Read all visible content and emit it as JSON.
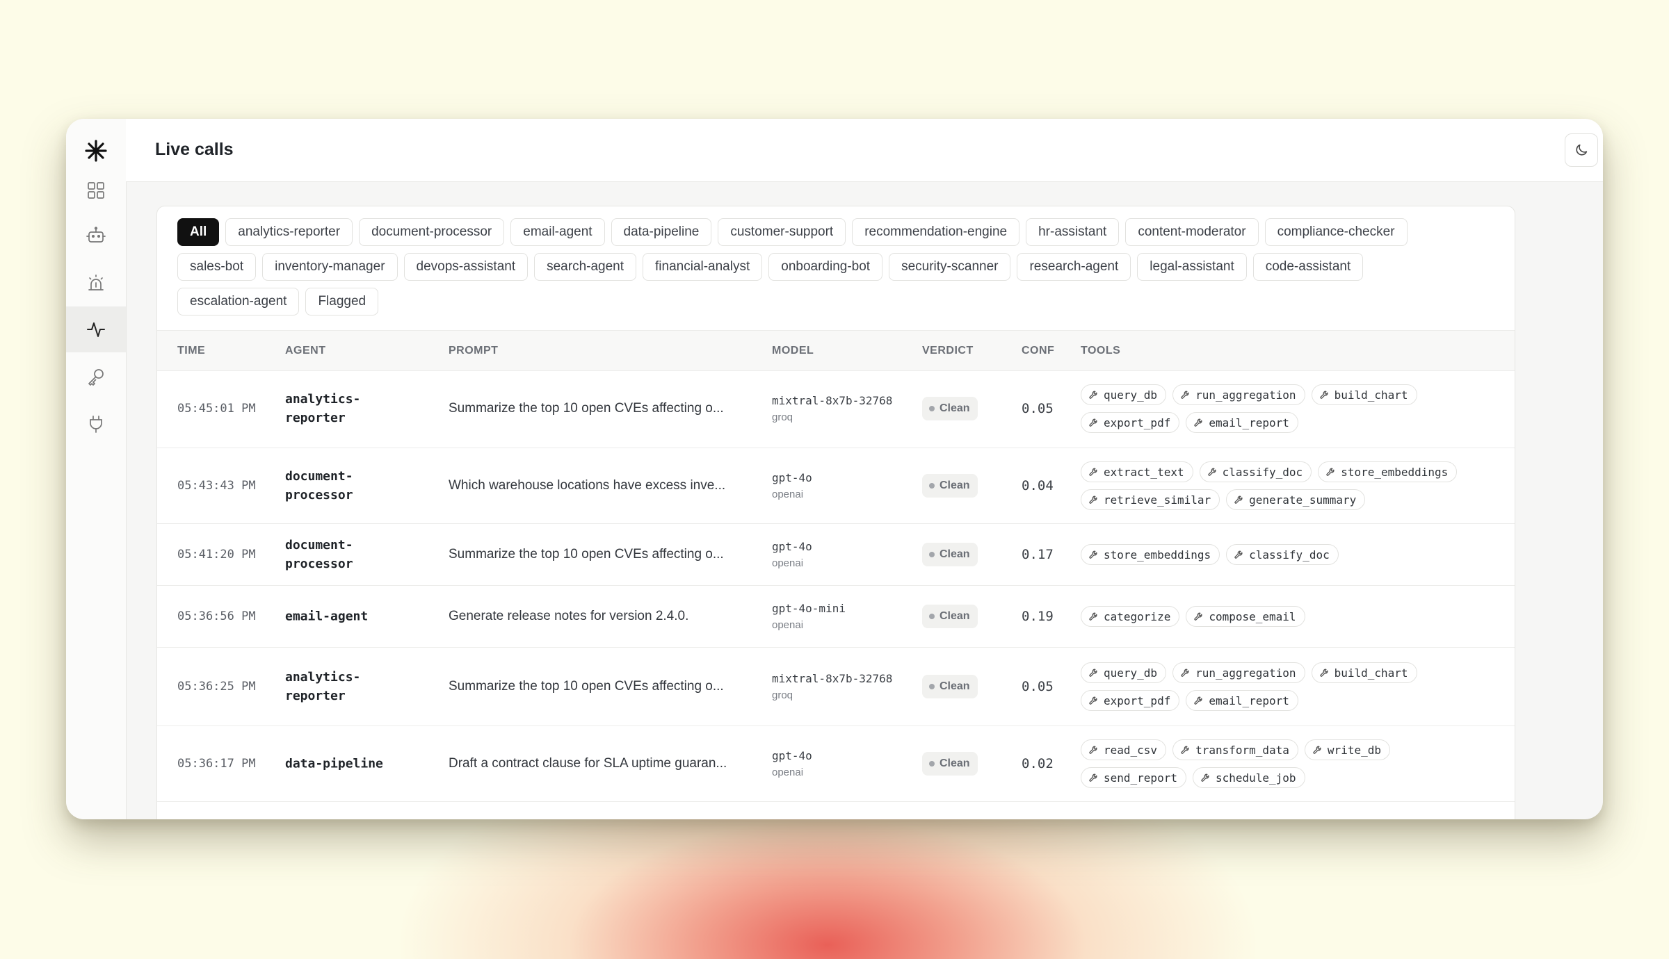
{
  "header": {
    "title": "Live calls"
  },
  "filters": [
    "All",
    "analytics-reporter",
    "document-processor",
    "email-agent",
    "data-pipeline",
    "customer-support",
    "recommendation-engine",
    "hr-assistant",
    "content-moderator",
    "compliance-checker",
    "sales-bot",
    "inventory-manager",
    "devops-assistant",
    "search-agent",
    "financial-analyst",
    "onboarding-bot",
    "security-scanner",
    "research-agent",
    "legal-assistant",
    "code-assistant",
    "escalation-agent",
    "Flagged"
  ],
  "active_filter": "All",
  "table": {
    "columns": [
      "TIME",
      "AGENT",
      "PROMPT",
      "MODEL",
      "VERDICT",
      "CONF",
      "TOOLS"
    ],
    "rows": [
      {
        "time": "05:45:01 PM",
        "agent": "analytics-reporter",
        "prompt": "Summarize the top 10 open CVEs affecting o...",
        "model": "mixtral-8x7b-32768",
        "provider": "groq",
        "verdict": "Clean",
        "conf": "0.05",
        "tools": [
          "query_db",
          "run_aggregation",
          "build_chart",
          "export_pdf",
          "email_report"
        ]
      },
      {
        "time": "05:43:43 PM",
        "agent": "document-processor",
        "prompt": "Which warehouse locations have excess inve...",
        "model": "gpt-4o",
        "provider": "openai",
        "verdict": "Clean",
        "conf": "0.04",
        "tools": [
          "extract_text",
          "classify_doc",
          "store_embeddings",
          "retrieve_similar",
          "generate_summary"
        ]
      },
      {
        "time": "05:41:20 PM",
        "agent": "document-processor",
        "prompt": "Summarize the top 10 open CVEs affecting o...",
        "model": "gpt-4o",
        "provider": "openai",
        "verdict": "Clean",
        "conf": "0.17",
        "tools": [
          "store_embeddings",
          "classify_doc"
        ]
      },
      {
        "time": "05:36:56 PM",
        "agent": "email-agent",
        "prompt": "Generate release notes for version 2.4.0.",
        "model": "gpt-4o-mini",
        "provider": "openai",
        "verdict": "Clean",
        "conf": "0.19",
        "tools": [
          "categorize",
          "compose_email"
        ]
      },
      {
        "time": "05:36:25 PM",
        "agent": "analytics-reporter",
        "prompt": "Summarize the top 10 open CVEs affecting o...",
        "model": "mixtral-8x7b-32768",
        "provider": "groq",
        "verdict": "Clean",
        "conf": "0.05",
        "tools": [
          "query_db",
          "run_aggregation",
          "build_chart",
          "export_pdf",
          "email_report"
        ]
      },
      {
        "time": "05:36:17 PM",
        "agent": "data-pipeline",
        "prompt": "Draft a contract clause for SLA uptime guaran...",
        "model": "gpt-4o",
        "provider": "openai",
        "verdict": "Clean",
        "conf": "0.02",
        "tools": [
          "read_csv",
          "transform_data",
          "write_db",
          "send_report",
          "schedule_job"
        ]
      }
    ]
  },
  "icons": {
    "logo": "asterisk-logo-icon",
    "nav": [
      "grid-icon",
      "robot-icon",
      "alarm-siren-icon",
      "activity-pulse-icon",
      "key-icon",
      "plug-icon"
    ],
    "theme_toggle": "moon-icon",
    "logout": "logout-icon",
    "tool": "wrench-icon"
  },
  "colors": {
    "accent": "#111111",
    "verdict_clean_bg": "#f1f1ef",
    "background": "#fdfce8"
  }
}
